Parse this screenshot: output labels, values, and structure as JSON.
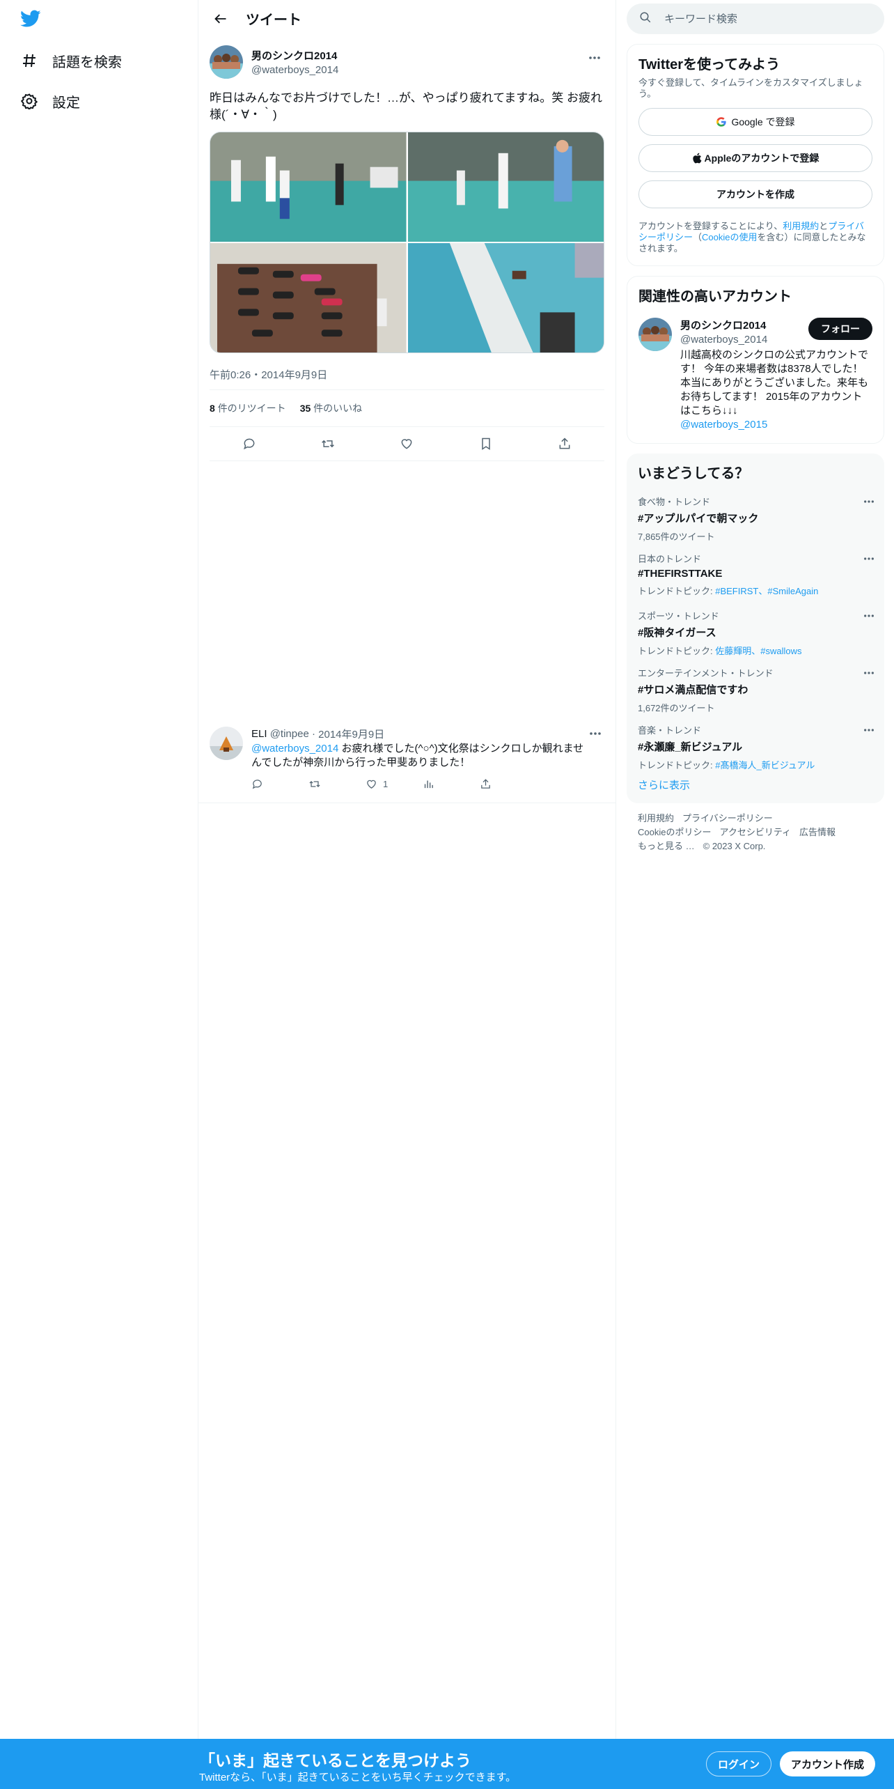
{
  "nav": {
    "explore_label": "話題を検索",
    "settings_label": "設定"
  },
  "header": {
    "title": "ツイート"
  },
  "tweet": {
    "author_name": "男のシンクロ2014",
    "author_handle": "@waterboys_2014",
    "text": "昨日はみんなでお片づけでした！…が、やっぱり疲れてますね。笑 お疲れ様(´・∀・｀)",
    "timestamp": "午前0:26・2014年9月9日",
    "retweets_count": "8",
    "retweets_label": "件のリツイート",
    "likes_count": "35",
    "likes_label": "件のいいね"
  },
  "reply": {
    "author_name": "ELI",
    "author_handle": "@tinpee",
    "date": "2014年9月9日",
    "mention": "@waterboys_2014",
    "text": " お疲れ様でした(^○^)文化祭はシンクロしか観れませんでしたが神奈川から行った甲斐ありました！",
    "like_count": "1"
  },
  "search": {
    "placeholder": "キーワード検索"
  },
  "signup_card": {
    "title": "Twitterを使ってみよう",
    "subtitle": "今すぐ登録して、タイムラインをカスタマイズしましょう。",
    "google_label": "Google で登録",
    "apple_label": "Appleのアカウントで登録",
    "create_label": "アカウントを作成",
    "legal_prefix": "アカウントを登録することにより、",
    "legal_terms": "利用規約",
    "legal_and": "と",
    "legal_privacy": "プライバシーポリシー",
    "legal_paren_open": "（",
    "legal_cookie": "Cookieの使用",
    "legal_suffix": "を含む）に同意したとみなされます。"
  },
  "related": {
    "title": "関連性の高いアカウント",
    "name": "男のシンクロ2014",
    "handle": "@waterboys_2014",
    "follow_label": "フォロー",
    "bio": "川越高校のシンクロの公式アカウントです！ 今年の来場者数は8378人でした！本当にありがとうございました。来年もお待ちしてます！ 2015年のアカウントはこちら↓↓↓",
    "bio_link": "@waterboys_2015"
  },
  "trends": {
    "title": "いまどうしてる？",
    "items": [
      {
        "category": "食べ物・トレンド",
        "name": "#アップルパイで朝マック",
        "meta": "7,865件のツイート",
        "topics": ""
      },
      {
        "category": "日本のトレンド",
        "name": "#THEFIRSTTAKE",
        "meta": "トレンドトピック: ",
        "topics": "#BEFIRST、#SmileAgain"
      },
      {
        "category": "スポーツ・トレンド",
        "name": "#阪神タイガース",
        "meta": "トレンドトピック: ",
        "topics": "佐藤輝明、#swallows"
      },
      {
        "category": "エンターテインメント・トレンド",
        "name": "#サロメ満点配信ですわ",
        "meta": "1,672件のツイート",
        "topics": ""
      },
      {
        "category": "音楽・トレンド",
        "name": "#永瀬廉_新ビジュアル",
        "meta": "トレンドトピック: ",
        "topics": "#髙橋海人_新ビジュアル"
      }
    ],
    "show_more": "さらに表示"
  },
  "footer": {
    "terms": "利用規約",
    "privacy": "プライバシーポリシー",
    "cookie": "Cookieのポリシー",
    "accessibility": "アクセシビリティ",
    "ads": "広告情報",
    "more": "もっと見る …",
    "copyright": "© 2023 X Corp."
  },
  "banner": {
    "title": "「いま」起きていることを見つけよう",
    "subtitle": "Twitterなら、「いま」起きていることをいち早くチェックできます。",
    "login_label": "ログイン",
    "signup_label": "アカウント作成"
  },
  "colors": {
    "brand": "#1d9bf0",
    "text": "#0f1419",
    "secondary": "#536471"
  }
}
